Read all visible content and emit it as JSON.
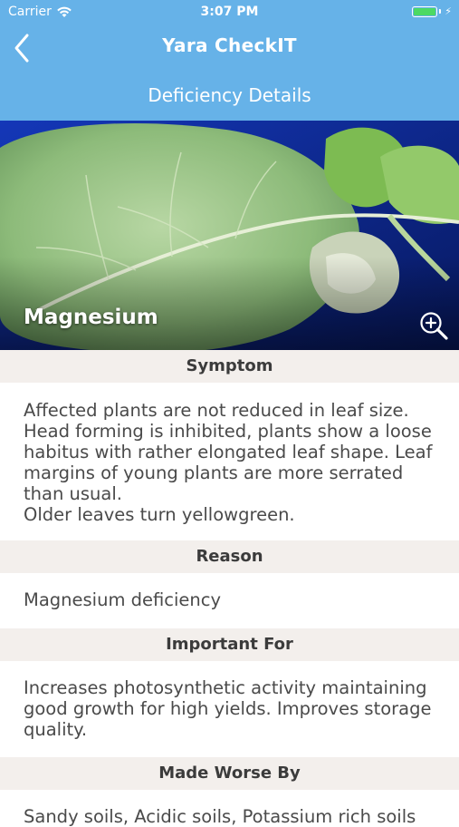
{
  "status_bar": {
    "carrier": "Carrier",
    "time": "3:07 PM"
  },
  "nav": {
    "title": "Yara CheckIT",
    "subtitle": "Deficiency Details"
  },
  "hero": {
    "label": "Magnesium"
  },
  "sections": {
    "symptom": {
      "header": "Symptom",
      "lines": [
        "Affected plants are not reduced in leaf size.",
        "Head forming is inhibited, plants show a loose",
        "habitus with rather elongated leaf shape. Leaf",
        "margins of young plants are more serrated",
        "than usual.",
        "Older leaves turn yellowgreen."
      ]
    },
    "reason": {
      "header": "Reason",
      "body": "Magnesium deficiency"
    },
    "important_for": {
      "header": "Important For",
      "lines": [
        "Increases photosynthetic activity maintaining",
        "good growth for high yields. Improves storage",
        "quality."
      ]
    },
    "made_worse_by": {
      "header": "Made Worse By",
      "body": "Sandy soils, Acidic soils, Potassium rich soils"
    }
  },
  "colors": {
    "nav_bar": "#66b2e8",
    "section_header_bg": "#f3efec",
    "battery": "#4cd964"
  }
}
